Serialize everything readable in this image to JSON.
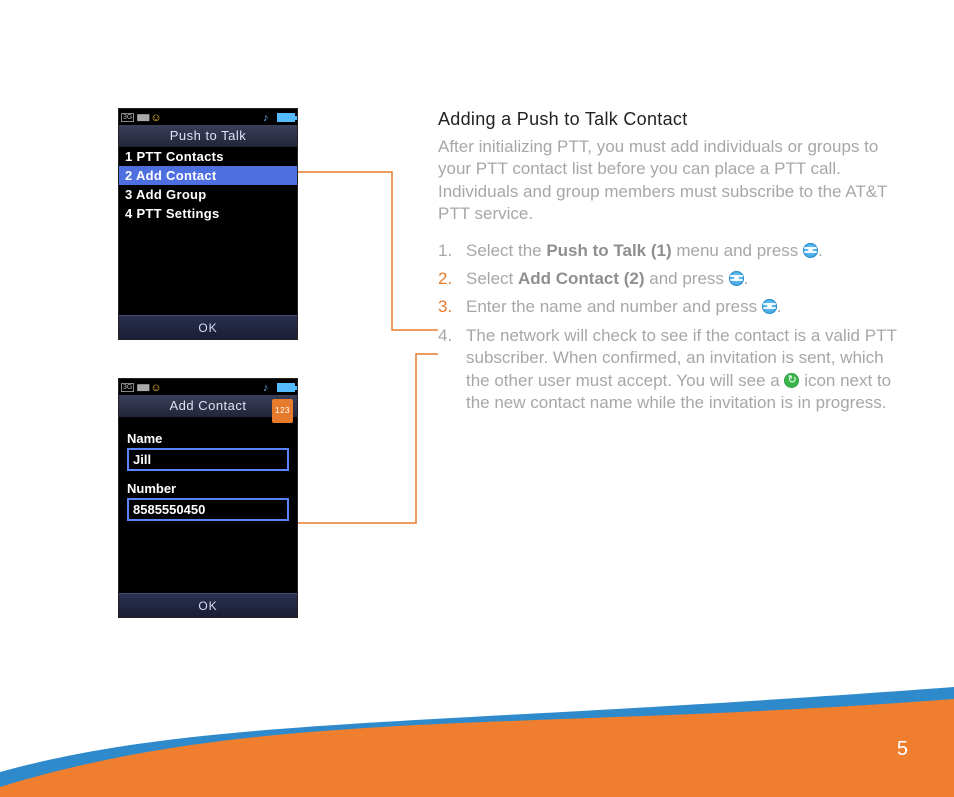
{
  "page_number": "5",
  "screen1": {
    "title": "Push to Talk",
    "items": [
      {
        "num": "1",
        "label": "PTT Contacts",
        "selected": false
      },
      {
        "num": "2",
        "label": "Add Contact",
        "selected": true
      },
      {
        "num": "3",
        "label": "Add Group",
        "selected": false
      },
      {
        "num": "4",
        "label": "PTT Settings",
        "selected": false
      }
    ],
    "softkey": "OK"
  },
  "screen2": {
    "title": "Add Contact",
    "input_mode": "123",
    "name_label": "Name",
    "name_value": "Jill",
    "number_label": "Number",
    "number_value": "8585550450",
    "softkey": "OK"
  },
  "doc": {
    "heading": "Adding a Push to Talk Contact",
    "intro": "After initializing PTT, you must add individuals or groups to your PTT contact list before you can place a PTT call. Individuals and group members must subscribe to the AT&T PTT service.",
    "steps": {
      "s1_a": "Select the ",
      "s1_bold": "Push to Talk (1)",
      "s1_b": " menu and press ",
      "s1_c": ".",
      "s2_a": "Select ",
      "s2_bold": "Add Contact (2)",
      "s2_b": " and press ",
      "s2_c": ".",
      "s3_a": "Enter the name and number and press ",
      "s3_b": ".",
      "s4_a": "The network will check to see if the contact is a valid PTT subscriber. When confirmed, an invitation is sent, which the other user must accept. You will see a ",
      "s4_b": " icon next to the new contact name while the invitation is in progress."
    },
    "nums": {
      "n1": "1.",
      "n2": "2.",
      "n3": "3.",
      "n4": "4."
    }
  },
  "colors": {
    "callout": "#e67b2d"
  }
}
